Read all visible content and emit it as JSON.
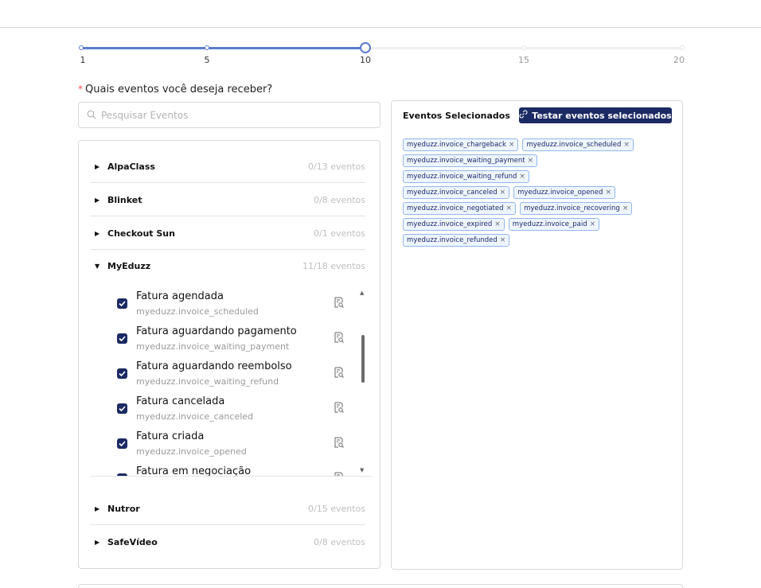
{
  "slider": {
    "marks": [
      "1",
      "5",
      "10",
      "15",
      "20"
    ],
    "value": 10,
    "min": 1,
    "max": 20
  },
  "question": {
    "required_mark": "*",
    "label": "Quais eventos você deseja receber?"
  },
  "search": {
    "placeholder": "Pesquisar Eventos"
  },
  "groups": [
    {
      "name": "AlpaClass",
      "count": "0/13 eventos",
      "expanded": false
    },
    {
      "name": "Blinket",
      "count": "0/8 eventos",
      "expanded": false
    },
    {
      "name": "Checkout Sun",
      "count": "0/1 eventos",
      "expanded": false
    },
    {
      "name": "MyEduzz",
      "count": "11/18 eventos",
      "expanded": true
    },
    {
      "name": "Nutror",
      "count": "0/15 eventos",
      "expanded": false
    },
    {
      "name": "SafeVídeo",
      "count": "0/8 eventos",
      "expanded": false
    }
  ],
  "myeduzz_events": [
    {
      "title": "Fatura agendada",
      "code": "myeduzz.invoice_scheduled",
      "checked": true
    },
    {
      "title": "Fatura aguardando pagamento",
      "code": "myeduzz.invoice_waiting_payment",
      "checked": true
    },
    {
      "title": "Fatura aguardando reembolso",
      "code": "myeduzz.invoice_waiting_refund",
      "checked": true
    },
    {
      "title": "Fatura cancelada",
      "code": "myeduzz.invoice_canceled",
      "checked": true
    },
    {
      "title": "Fatura criada",
      "code": "myeduzz.invoice_opened",
      "checked": true
    },
    {
      "title": "Fatura em negociação",
      "code": "",
      "checked": true
    }
  ],
  "selected_panel": {
    "title": "Eventos Selecionados",
    "test_button": "Testar eventos selecionados",
    "remove_symbol": "×",
    "tag_rows": [
      [
        "myeduzz.invoice_chargeback",
        "myeduzz.invoice_scheduled"
      ],
      [
        "myeduzz.invoice_waiting_payment"
      ],
      [
        "myeduzz.invoice_waiting_refund"
      ],
      [
        "myeduzz.invoice_canceled",
        "myeduzz.invoice_opened"
      ],
      [
        "myeduzz.invoice_negotiated",
        "myeduzz.invoice_recovering"
      ],
      [
        "myeduzz.invoice_expired",
        "myeduzz.invoice_paid"
      ],
      [
        "myeduzz.invoice_refunded"
      ]
    ]
  },
  "icons": {
    "search": "search-icon",
    "expand_collapsed": "caret-right-icon",
    "expand_open": "caret-down-icon",
    "event_detail": "document-search-icon",
    "test": "link-icon",
    "checkbox": "checkbox-checked-icon"
  },
  "colors": {
    "primary": "#1b2a63",
    "slider_track": "#5b7ccb",
    "tag_background": "#eef5ff",
    "tag_border": "#91b7ec",
    "required": "#ff4d4f"
  }
}
